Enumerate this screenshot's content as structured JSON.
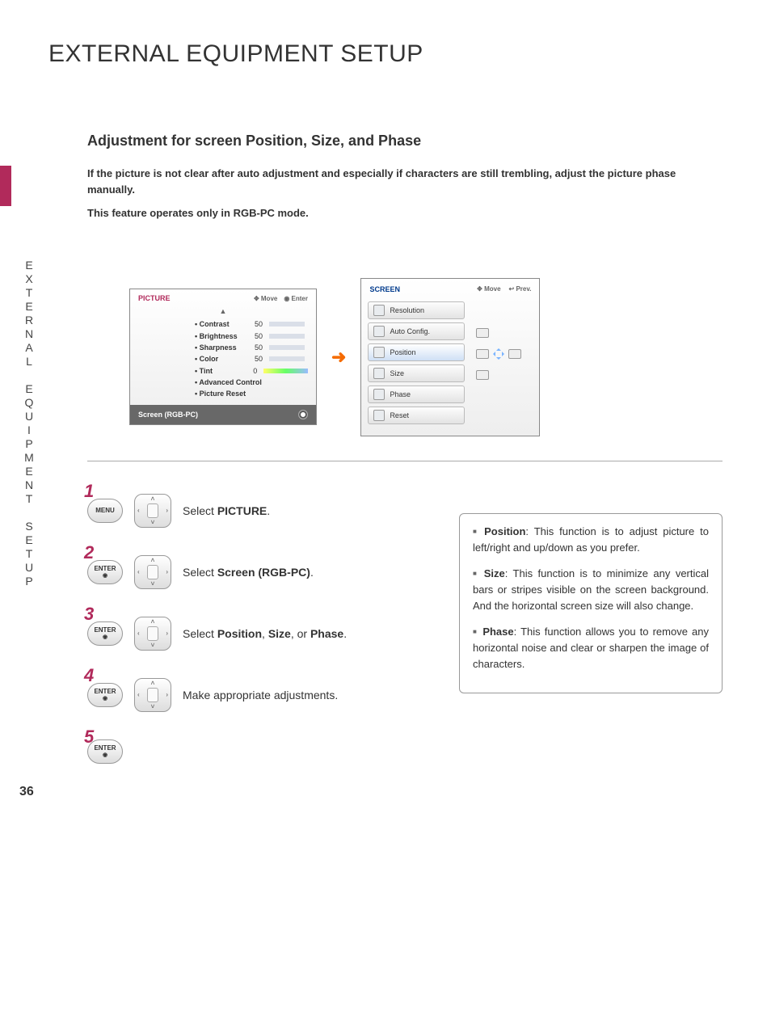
{
  "page": {
    "number": "36",
    "title": "EXTERNAL EQUIPMENT SETUP",
    "side_label": "EXTERNAL EQUIPMENT SETUP",
    "subtitle": "Adjustment for screen Position, Size, and Phase",
    "intro1": "If the picture is not clear after auto adjustment and especially if characters are still trembling, adjust the picture phase manually.",
    "intro2": "This feature operates only in RGB-PC mode."
  },
  "picture_panel": {
    "title": "PICTURE",
    "hint_move": "Move",
    "hint_enter": "Enter",
    "rows": [
      {
        "label": "• Contrast",
        "value": "50"
      },
      {
        "label": "• Brightness",
        "value": "50"
      },
      {
        "label": "• Sharpness",
        "value": "50"
      },
      {
        "label": "• Color",
        "value": "50"
      }
    ],
    "tint_label": "• Tint",
    "tint_value": "0",
    "advanced": "• Advanced Control",
    "reset": "• Picture Reset",
    "footer": "Screen (RGB-PC)"
  },
  "screen_panel": {
    "title": "SCREEN",
    "hint_move": "Move",
    "hint_prev": "Prev.",
    "items": [
      "Resolution",
      "Auto Config.",
      "Position",
      "Size",
      "Phase",
      "Reset"
    ]
  },
  "steps": {
    "s1_btn": "MENU",
    "s1_text_a": "Select ",
    "s1_text_b": "PICTURE",
    "s1_text_c": ".",
    "s2_btn": "ENTER",
    "s2_text_a": "Select ",
    "s2_text_b": "Screen (RGB-PC)",
    "s2_text_c": ".",
    "s3_btn": "ENTER",
    "s3_text_a": "Select ",
    "s3_text_b": "Position",
    "s3_text_c": ", ",
    "s3_text_d": "Size",
    "s3_text_e": ", or ",
    "s3_text_f": "Phase",
    "s3_text_g": ".",
    "s4_btn": "ENTER",
    "s4_text": "Make appropriate adjustments.",
    "s5_btn": "ENTER"
  },
  "infobox": {
    "i1_b": "Position",
    "i1_t": ": This function is to adjust picture to left/right and up/down as you prefer.",
    "i2_b": "Size",
    "i2_t": ": This function is to minimize any vertical bars or stripes visible on the screen background. And the horizontal screen size will also change.",
    "i3_b": "Phase",
    "i3_t": ": This function allows you to remove any horizontal noise and clear or sharpen the image of characters."
  }
}
